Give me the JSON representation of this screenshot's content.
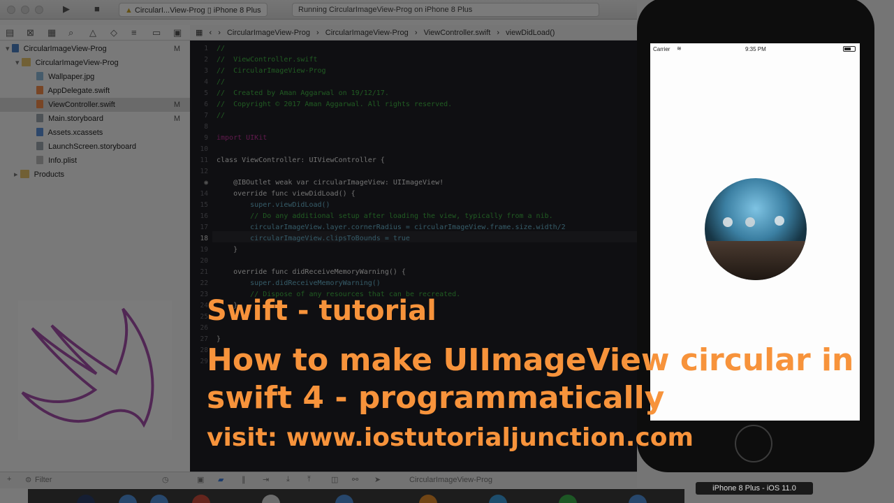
{
  "toolbar": {
    "scheme": "CircularI...View-Prog",
    "device": "iPhone 8 Plus",
    "activity": "Running CircularImageView-Prog on iPhone 8 Plus"
  },
  "navigator": {
    "items": [
      {
        "label": "CircularImageView-Prog",
        "badge": "M"
      },
      {
        "label": "CircularImageView-Prog",
        "badge": ""
      },
      {
        "label": "Wallpaper.jpg",
        "badge": ""
      },
      {
        "label": "AppDelegate.swift",
        "badge": ""
      },
      {
        "label": "ViewController.swift",
        "badge": "M"
      },
      {
        "label": "Main.storyboard",
        "badge": "M"
      },
      {
        "label": "Assets.xcassets",
        "badge": ""
      },
      {
        "label": "LaunchScreen.storyboard",
        "badge": ""
      },
      {
        "label": "Info.plist",
        "badge": ""
      },
      {
        "label": "Products",
        "badge": ""
      }
    ],
    "filter_placeholder": "Filter"
  },
  "jumpbar": {
    "crumbs": [
      "CircularImageView-Prog",
      "CircularImageView-Prog",
      "ViewController.swift",
      "viewDidLoad()"
    ]
  },
  "editor": {
    "line_numbers": [
      "1",
      "2",
      "3",
      "4",
      "5",
      "6",
      "7",
      "8",
      "9",
      "10",
      "11",
      "12",
      "13",
      "14",
      "15",
      "16",
      "17",
      "18",
      "19",
      "20",
      "21",
      "22",
      "23",
      "24",
      "25",
      "26",
      "27",
      "28",
      "29"
    ],
    "lines": [
      "//",
      "//  ViewController.swift",
      "//  CircularImageView-Prog",
      "//",
      "//  Created by Aman Aggarwal on 19/12/17.",
      "//  Copyright © 2017 Aman Aggarwal. All rights reserved.",
      "//",
      "",
      "import UIKit",
      "",
      "class ViewController: UIViewController {",
      "",
      "    @IBOutlet weak var circularImageView: UIImageView!",
      "    override func viewDidLoad() {",
      "        super.viewDidLoad()",
      "        // Do any additional setup after loading the view, typically from a nib.",
      "        circularImageView.layer.cornerRadius = circularImageView.frame.size.width/2",
      "        circularImageView.clipsToBounds = true",
      "    }",
      "",
      "    override func didReceiveMemoryWarning() {",
      "        super.didReceiveMemoryWarning()",
      "        // Dispose of any resources that can be recreated.",
      "    }",
      "",
      "",
      "}",
      "",
      ""
    ],
    "current_line": "18"
  },
  "statusbar": {
    "target": "CircularImageView-Prog"
  },
  "simulator": {
    "carrier": "Carrier",
    "time": "9:35 PM",
    "device_label": "iPhone 8 Plus - iOS 11.0"
  },
  "overlay": {
    "line1": "Swift - tutorial",
    "line2": "How to make UIImageView circular in",
    "line3": "swift 4 - programmatically",
    "line4": "visit: www.iostutorialjunction.com"
  },
  "colors": {
    "overlay_text": "#f7933b",
    "editor_bg": "#1f1f24",
    "comment": "#41b645",
    "keyword": "#c2349b"
  }
}
